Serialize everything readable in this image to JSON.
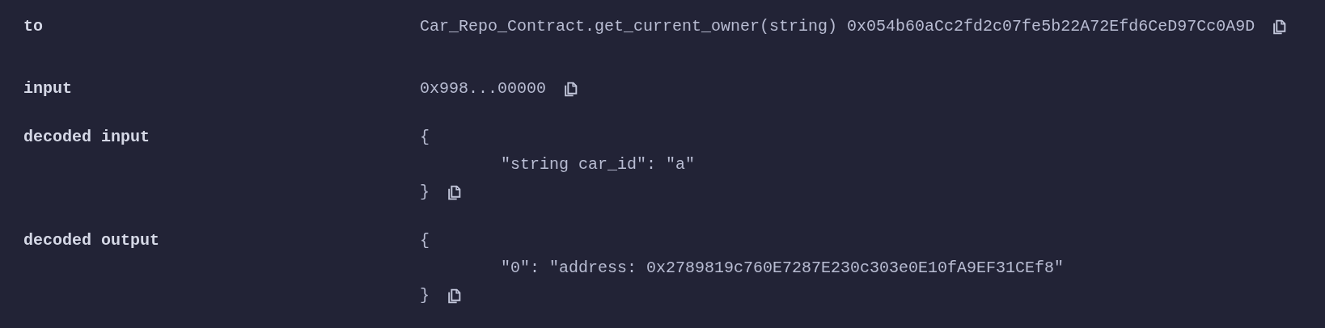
{
  "rows": [
    {
      "label": "to",
      "kind": "text",
      "value": "Car_Repo_Contract.get_current_owner(string) 0x054b60aCc2fd2c07fe5b22A72Efd6CeD97Cc0A9D"
    },
    {
      "label": "input",
      "kind": "text",
      "value": "0x998...00000"
    },
    {
      "label": "decoded input",
      "kind": "object",
      "open": "{",
      "lines": [
        "\"string car_id\": \"a\""
      ],
      "close": "}"
    },
    {
      "label": "decoded output",
      "kind": "object",
      "open": "{",
      "lines": [
        "\"0\": \"address: 0x2789819c760E7287E230c303e0E10fA9EF31CEf8\""
      ],
      "close": "}"
    }
  ]
}
